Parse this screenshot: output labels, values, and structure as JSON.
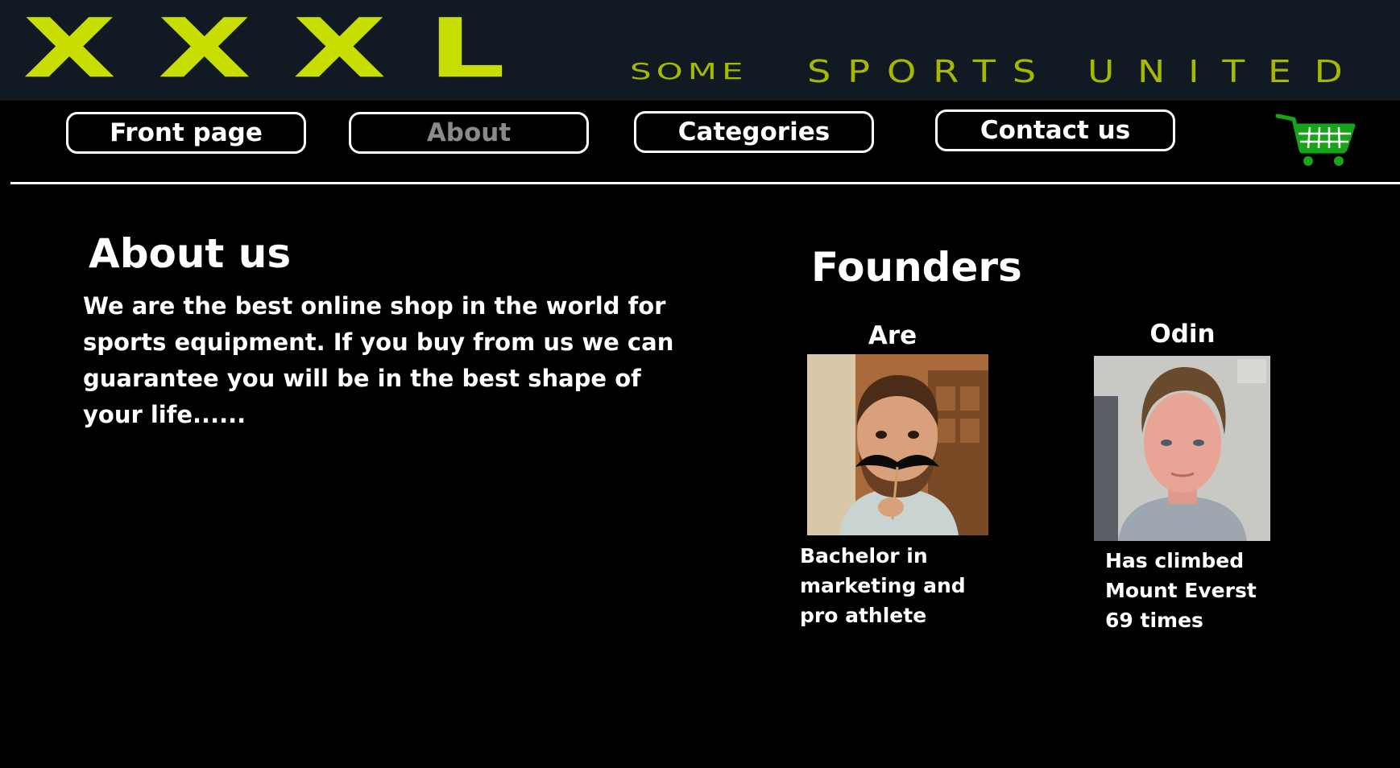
{
  "header": {
    "logo_text": "XXXL",
    "tagline_part1": "SOME",
    "tagline_part2": "SPORTS",
    "tagline_part3": "UNITED"
  },
  "nav": {
    "items": [
      {
        "label": "Front page"
      },
      {
        "label": "About"
      },
      {
        "label": "Categories"
      },
      {
        "label": "Contact us"
      }
    ],
    "active_index": 1,
    "cart_icon": "shopping-cart-icon"
  },
  "about": {
    "title": "About us",
    "text": "We are the best online shop in the world for sports equipment. If you buy from us we can guarantee you will be in the best shape of your life......"
  },
  "founders": {
    "title": "Founders",
    "people": [
      {
        "name": "Are",
        "description": "Bachelor in marketing and pro athlete"
      },
      {
        "name": "Odin",
        "description": "Has climbed Mount Everst 69 times"
      }
    ]
  },
  "colors": {
    "brand_yellow": "#c8de00",
    "header_bg": "#111a22",
    "page_bg": "#000000",
    "cart_green": "#18a418",
    "text": "#ffffff",
    "active_nav": "#8a8a8a"
  }
}
